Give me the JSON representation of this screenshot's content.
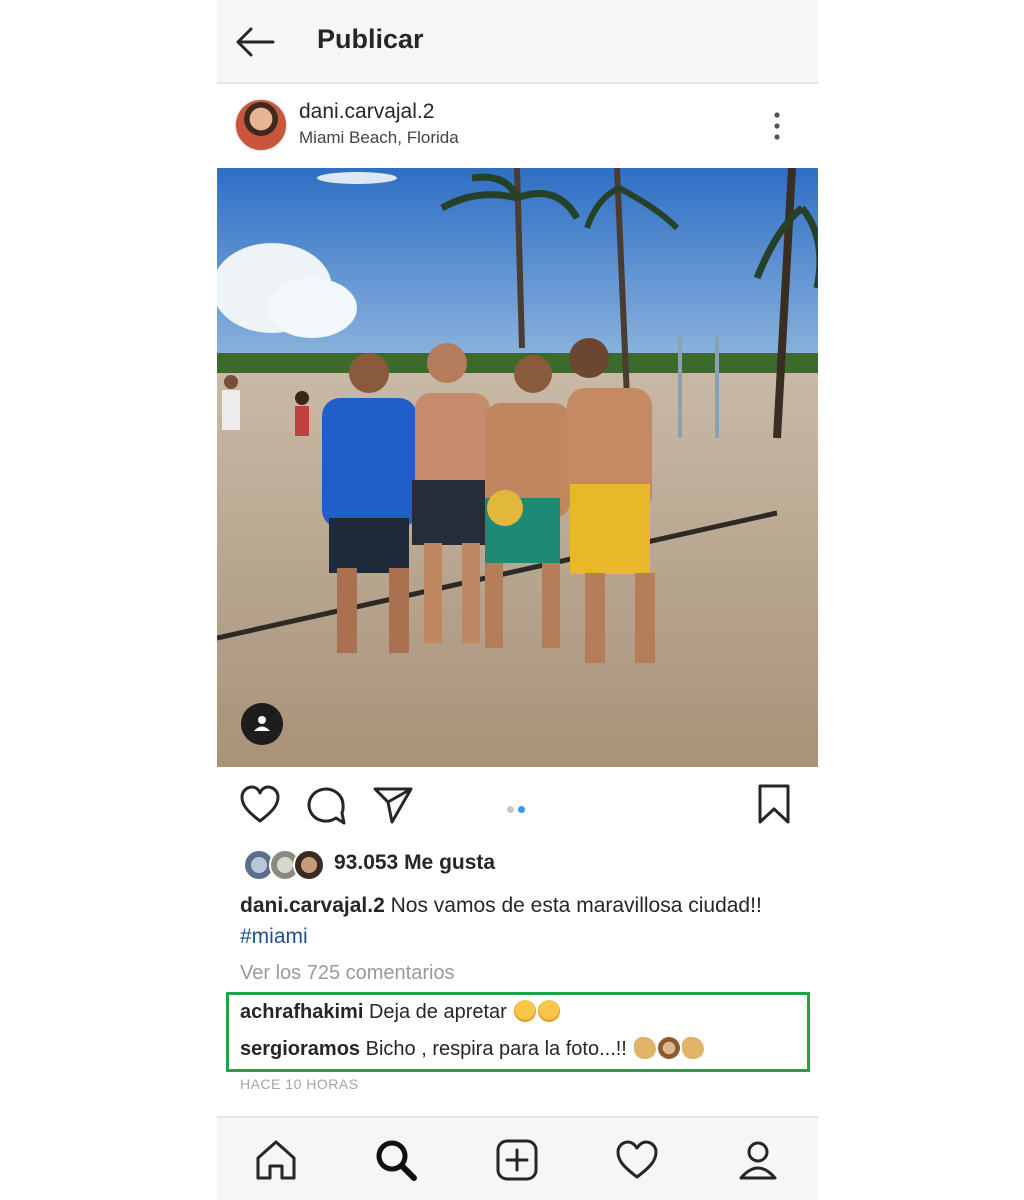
{
  "header": {
    "title": "Publicar",
    "back_icon": "arrow-left-icon"
  },
  "post": {
    "username": "dani.carvajal.2",
    "location": "Miami Beach, Florida",
    "more_icon": "more-vertical-icon",
    "photo_icons": {
      "tag": "user-tag-icon"
    },
    "carousel": {
      "count": 2,
      "active_index": 1
    },
    "likes_text": "93.053 Me gusta",
    "caption": {
      "username": "dani.carvajal.2",
      "text": "Nos vamos de esta maravillosa ciudad!!",
      "hashtag": "#miami"
    },
    "view_comments": "Ver los 725 comentarios",
    "comments": [
      {
        "username": "achrafhakimi",
        "text": "Deja de apretar"
      },
      {
        "username": "sergioramos",
        "text": "Bicho , respira para la foto...!!"
      }
    ],
    "timestamp": "HACE 10 HORAS",
    "highlight_color": "#22a34a"
  },
  "actions": {
    "like_icon": "heart-icon",
    "comment_icon": "comment-icon",
    "share_icon": "send-icon",
    "save_icon": "bookmark-icon"
  },
  "bottom_nav": [
    "home-icon",
    "search-icon",
    "add-post-icon",
    "activity-heart-icon",
    "profile-icon"
  ],
  "colors": {
    "accent": "#3897f0",
    "hashtag": "#1f4f8c"
  }
}
